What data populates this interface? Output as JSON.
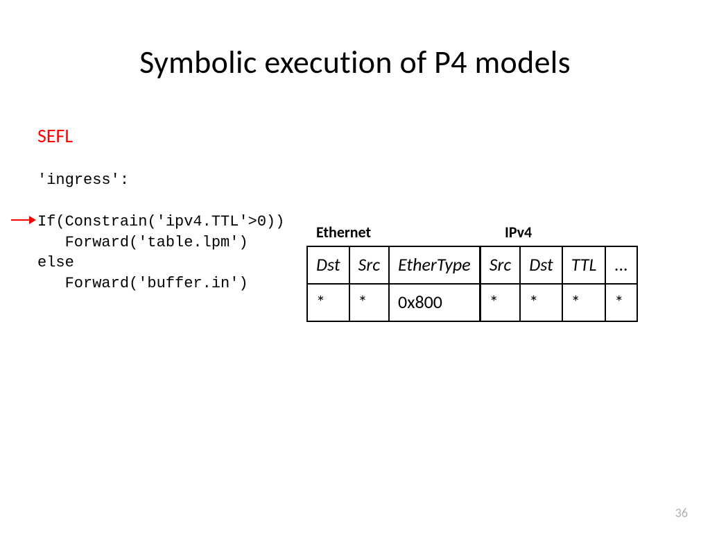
{
  "title": "Symbolic execution of P4 models",
  "sefl_label": "SEFL",
  "code": {
    "ingress": "'ingress':",
    "line1": "If(Constrain('ipv4.TTL'>0))",
    "line2": "   Forward('table.lpm')",
    "line3": "else",
    "line4": "   Forward('buffer.in')"
  },
  "headers": {
    "ethernet": "Ethernet",
    "ipv4": "IPv4"
  },
  "table": {
    "cols": [
      "Dst",
      "Src",
      "EtherType",
      "Src",
      "Dst",
      "TTL",
      "..."
    ],
    "vals": [
      "*",
      "*",
      "0x800",
      "*",
      "*",
      "*",
      "*"
    ]
  },
  "page_number": "36"
}
